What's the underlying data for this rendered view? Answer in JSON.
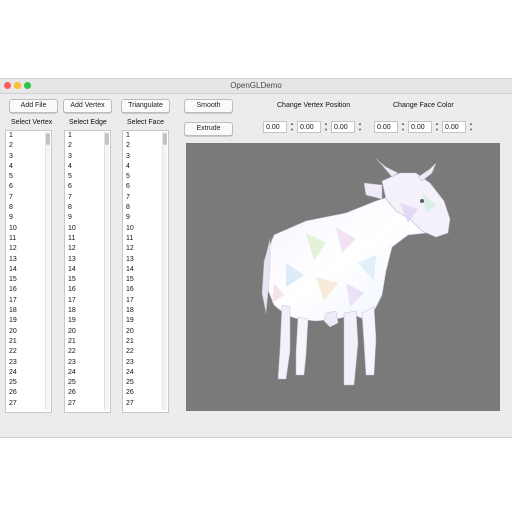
{
  "window": {
    "title": "OpenGLDemo"
  },
  "toolbar": {
    "add_file": "Add File",
    "add_vertex": "Add Vertex",
    "triangulate": "Triangulate",
    "smooth": "Smooth",
    "extrude": "Extrude"
  },
  "lists": {
    "vertex_label": "Select Vertex",
    "edge_label": "Select Edge",
    "face_label": "Select Face",
    "items": [
      "1",
      "2",
      "3",
      "4",
      "5",
      "6",
      "7",
      "8",
      "9",
      "10",
      "11",
      "12",
      "13",
      "14",
      "15",
      "16",
      "17",
      "18",
      "19",
      "20",
      "21",
      "22",
      "23",
      "24",
      "25",
      "26",
      "27"
    ]
  },
  "vertex_position": {
    "label": "Change Vertex Position",
    "x": "0.00",
    "y": "0.00",
    "z": "0.00"
  },
  "face_color": {
    "label": "Change Face Color",
    "r": "0.00",
    "g": "0.00",
    "b": "0.00"
  },
  "colors": {
    "viewport_bg": "#7a7a7a",
    "close": "#fc5f57",
    "minimize": "#fdbc2e",
    "maximize": "#28c840"
  }
}
